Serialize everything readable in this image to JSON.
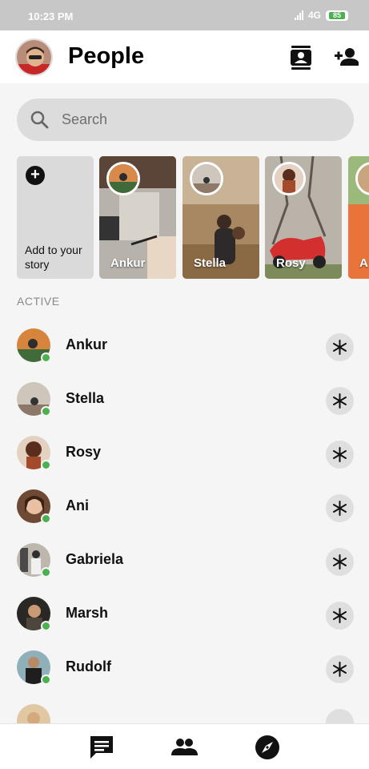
{
  "status_bar": {
    "time": "10:23 PM",
    "network": "4G",
    "battery": "85"
  },
  "header": {
    "title": "People"
  },
  "search": {
    "placeholder": "Search"
  },
  "stories": {
    "add_label": "Add to your story",
    "items": [
      {
        "name": "Ankur"
      },
      {
        "name": "Stella"
      },
      {
        "name": "Rosy"
      },
      {
        "name": "A"
      }
    ]
  },
  "active": {
    "heading": "ACTIVE",
    "people": [
      {
        "name": "Ankur"
      },
      {
        "name": "Stella"
      },
      {
        "name": "Rosy"
      },
      {
        "name": "Ani"
      },
      {
        "name": "Gabriela"
      },
      {
        "name": "Marsh"
      },
      {
        "name": "Rudolf"
      }
    ]
  },
  "colors": {
    "online": "#4caf50",
    "battery": "#4caf50"
  },
  "icons": {
    "header": [
      "contacts-icon",
      "add-person-icon"
    ],
    "search": "search-icon",
    "wave": "wave-icon",
    "nav": [
      "chats-icon",
      "people-icon",
      "discover-icon"
    ]
  }
}
